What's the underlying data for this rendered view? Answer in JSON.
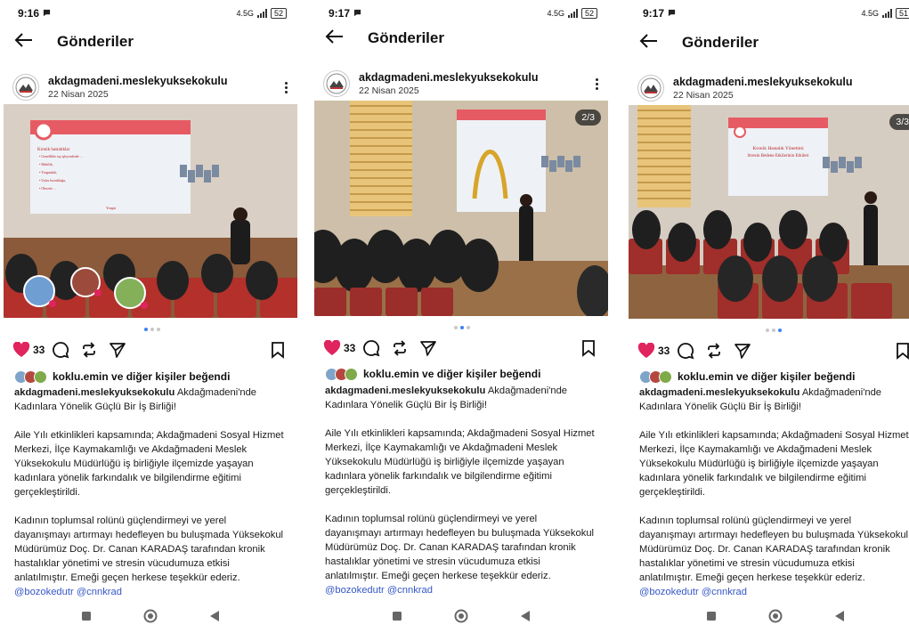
{
  "colors": {
    "heart": "#e0245e",
    "accent": "#3b82f6",
    "mention": "#3557c8",
    "slide_bar": "#e65b63"
  },
  "screens": [
    {
      "time": "9:16",
      "network": "4.5G",
      "battery": "52",
      "title": "Gönderiler",
      "account": "akdagmadeni.meslekyuksekokulu",
      "date": "22 Nisan 2025",
      "counter": "",
      "active_dot": 0
    },
    {
      "time": "9:17",
      "network": "4.5G",
      "battery": "52",
      "title": "Gönderiler",
      "account": "akdagmadeni.meslekyuksekokulu",
      "date": "22 Nisan 2025",
      "counter": "2/3",
      "active_dot": 1
    },
    {
      "time": "9:17",
      "network": "4.5G",
      "battery": "51",
      "title": "Gönderiler",
      "account": "akdagmadeni.meslekyuksekokulu",
      "date": "22 Nisan 2025",
      "counter": "3/3",
      "active_dot": 2
    }
  ],
  "post": {
    "like_count": "33",
    "liked_by_user": "koklu.emin",
    "liked_by_rest": " ve diğer kişiler beğendi",
    "caption_user": "akdagmadeni.meslekyuksekokulu",
    "caption_title": " Akdağmadeni'nde Kadınlara Yönelik Güçlü Bir İş Birliği!",
    "paragraph1": "Aile Yılı etkinlikleri kapsamında; Akdağmadeni Sosyal Hizmet Merkezi, İlçe Kaymakamlığı ve Akdağmadeni Meslek Yüksekokulu Müdürlüğü iş birliğiyle ilçemizde yaşayan kadınlara yönelik farkındalık ve bilgilendirme eğitimi gerçekleştirildi.",
    "paragraph2": "Kadının toplumsal rolünü güçlendirmeyi ve yerel dayanışmayı artırmayı hedefleyen bu buluşmada Yüksekokul Müdürümüz Doç. Dr. Canan KARADAŞ tarafından kronik hastalıklar yönetimi ve stresin vücudumuza etkisi anlatılmıştır. Emeği geçen herkese teşekkür ederiz. ",
    "mentions": "@bozokedutr @cnnkrad"
  },
  "slides": {
    "s1_heading": "Kronik hastalıklar",
    "s1_lines": [
      "Genellikle taş işleyenlerde ...",
      "Bitkilik,",
      "Yorgunluk,",
      "Uyku bozukluğu,",
      "Obezite ..."
    ],
    "s1_footer": "Yozgat",
    "s3_title_line1": "Kronik Hastalık Yönetimi",
    "s3_title_line2": "Stresin Bedene Etkilerinin Etkileri"
  },
  "icons": {
    "back": "arrow-left-icon",
    "more": "more-vertical-icon",
    "like": "heart-icon",
    "comment": "comment-icon",
    "repost": "repost-icon",
    "share": "send-icon",
    "save": "bookmark-icon",
    "nav_recent": "square-icon",
    "nav_home": "circle-icon",
    "nav_back": "triangle-back-icon"
  }
}
